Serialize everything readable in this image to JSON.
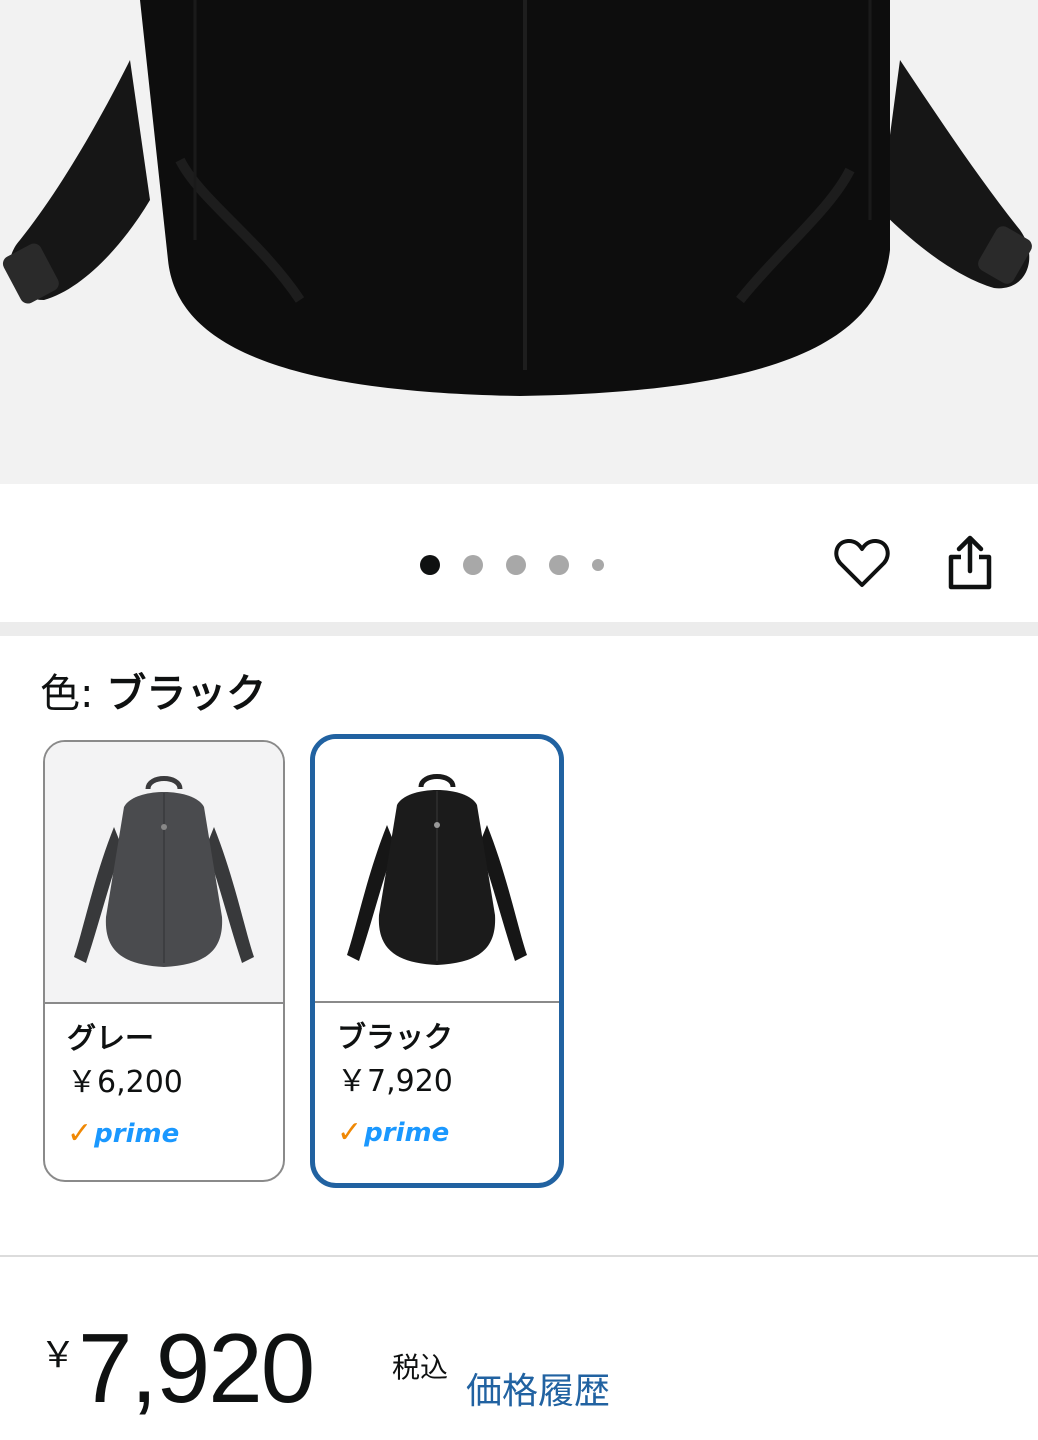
{
  "hero": {
    "image": "black-backpack-closeup"
  },
  "carousel": {
    "total": 5,
    "active_index": 0
  },
  "actions": {
    "favorite_icon": "heart-icon",
    "share_icon": "share-icon"
  },
  "color_selector": {
    "label": "色:",
    "selected": "ブラック",
    "options": [
      {
        "name": "グレー",
        "price": "￥6,200",
        "prime": "prime",
        "selected": false
      },
      {
        "name": "ブラック",
        "price": "￥7,920",
        "prime": "prime",
        "selected": true
      }
    ]
  },
  "pricing": {
    "currency": "￥",
    "amount": "7,920",
    "tax_note": "税込",
    "history_link": "価格履歴"
  },
  "colors": {
    "accent_blue": "#2162a1",
    "prime_blue": "#1a98ff",
    "prime_orange": "#f08804"
  }
}
